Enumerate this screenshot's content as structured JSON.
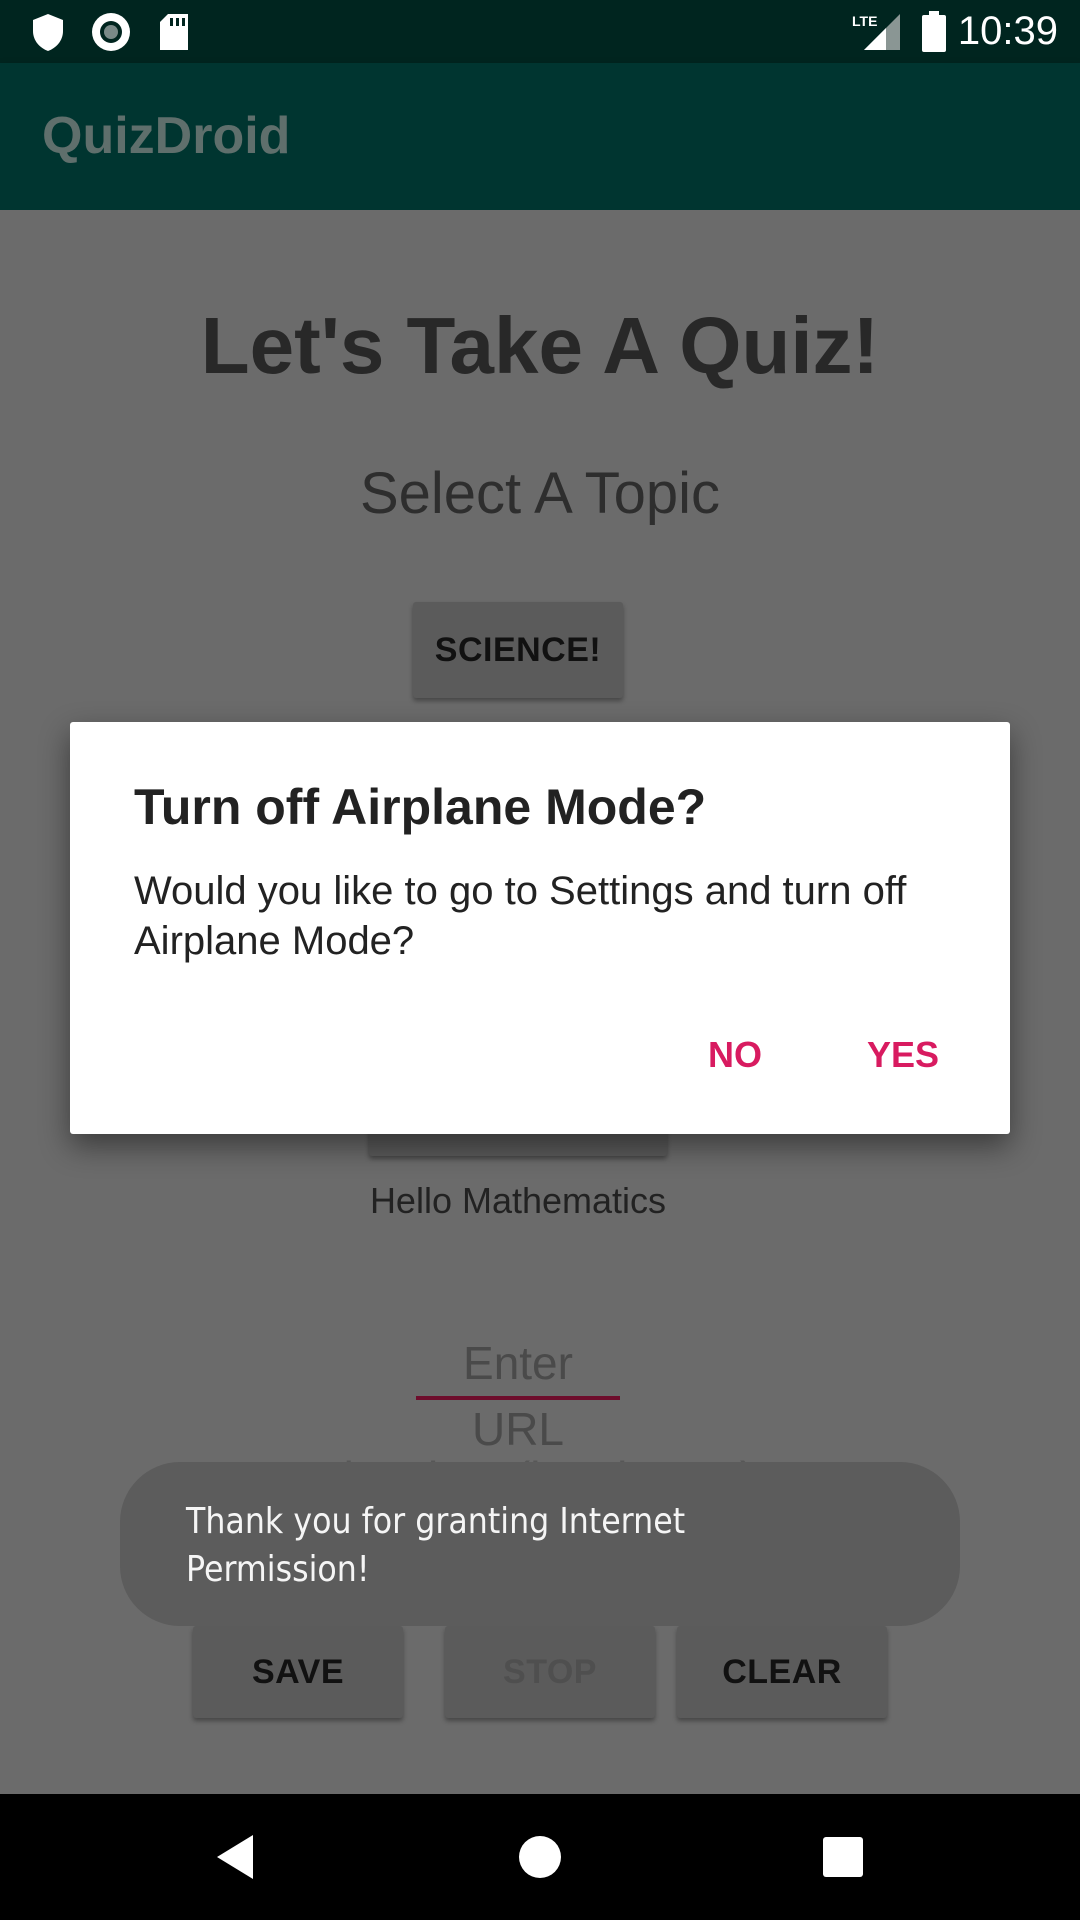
{
  "status_bar": {
    "time": "10:39",
    "network": "LTE",
    "icons": [
      "shield-icon",
      "record-icon",
      "sd-card-icon",
      "signal-icon",
      "battery-icon"
    ]
  },
  "app_bar": {
    "title": "QuizDroid"
  },
  "main": {
    "heading": "Let's Take A Quiz!",
    "subheading": "Select A Topic",
    "science_button": "SCIENCE!",
    "math_label": "Hello Mathematics",
    "url_placeholder": "Enter URL",
    "delay_placeholder": "Delay time (in minutes)",
    "save_button": "SAVE",
    "stop_button": "STOP",
    "clear_button": "CLEAR"
  },
  "dialog": {
    "title": "Turn off Airplane Mode?",
    "message": "Would you like to go to Settings and turn off Airplane Mode?",
    "no_button": "NO",
    "yes_button": "YES"
  },
  "toast": {
    "message": "Thank you for granting Internet Permission!"
  },
  "colors": {
    "status_bar": "#00251f",
    "app_bar": "#003530",
    "accent": "#d81b60",
    "scrim_background": "#6b6b6b"
  },
  "nav_bar": {
    "icons": [
      "back-icon",
      "home-icon",
      "recents-icon"
    ]
  }
}
